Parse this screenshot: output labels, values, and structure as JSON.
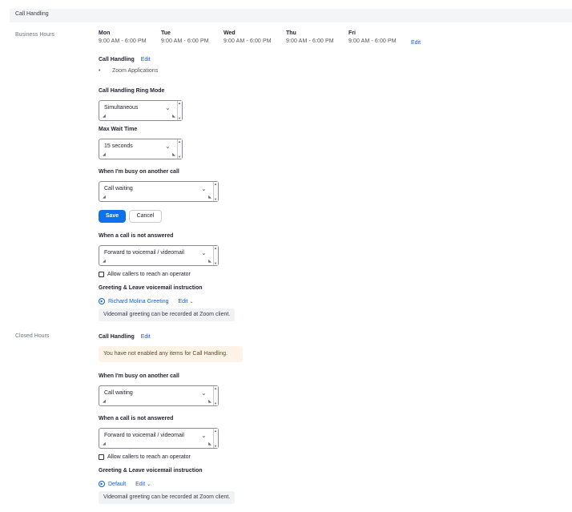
{
  "section_title": "Call Handling",
  "business_hours": {
    "label": "Business Hours",
    "days": [
      {
        "name": "Mon",
        "time": "9:00 AM - 6:00 PM"
      },
      {
        "name": "Tue",
        "time": "9:00 AM - 6:00 PM"
      },
      {
        "name": "Wed",
        "time": "9:00 AM - 6:00 PM"
      },
      {
        "name": "Thu",
        "time": "9:00 AM - 6:00 PM"
      },
      {
        "name": "Fri",
        "time": "9:00 AM - 6:00 PM"
      }
    ],
    "edit_hours": "Edit",
    "call_handling_label": "Call Handling",
    "call_handling_edit": "Edit",
    "call_handling_item": "Zoom Applications",
    "ring_mode_label": "Call Handling Ring Mode",
    "ring_mode_value": "Simultaneous",
    "max_wait_label": "Max Wait Time",
    "max_wait_value": "15 seconds",
    "busy_label": "When I'm busy on another call",
    "busy_value": "Call waiting",
    "save": "Save",
    "cancel": "Cancel",
    "not_answered_label": "When a call is not answered",
    "not_answered_value": "Forward to voicemail / videomail",
    "allow_operator": "Allow callers to reach an operator",
    "allow_operator_checked": false,
    "greeting_label": "Greeting & Leave voicemail instruction",
    "greeting_name": "Richard Molina Greeting",
    "greeting_edit": "Edit",
    "greeting_note": "Videomail greeting can be recorded at Zoom client."
  },
  "closed_hours": {
    "label": "Closed Hours",
    "call_handling_label": "Call Handling",
    "call_handling_edit": "Edit",
    "warning": "You have not enabled any items for Call Handling.",
    "busy_label": "When I'm busy on another call",
    "busy_value": "Call waiting",
    "not_answered_label": "When a call is not answered",
    "not_answered_value": "Forward to voicemail / videomail",
    "allow_operator": "Allow callers to reach an operator",
    "allow_operator_checked": false,
    "greeting_label": "Greeting & Leave voicemail instruction",
    "greeting_name": "Default",
    "greeting_edit": "Edit",
    "greeting_note": "Videomail greeting can be recorded at Zoom client."
  },
  "icons": {
    "play": "play-circle-icon",
    "chevron": "chevron-down-icon"
  },
  "colors": {
    "accent": "#0e71eb",
    "link": "#0e5fd6",
    "warning_bg": "#fdf3e6",
    "info_bg": "#f1f2f4"
  }
}
